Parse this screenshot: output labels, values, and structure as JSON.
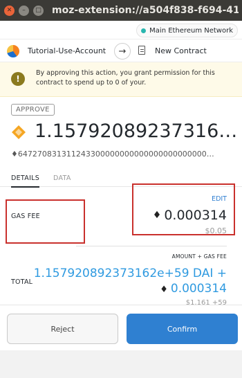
{
  "window": {
    "title": "moz-extension://a504f838-f694-413d-",
    "close_glyph": "✕",
    "minimize_glyph": "–",
    "maximize_glyph": "□"
  },
  "network": {
    "label": "Main Ethereum Network",
    "status_color": "#29b6af"
  },
  "account_bar": {
    "account_name": "Tutorial-Use-Account",
    "arrow_icon": "arrow-right-icon",
    "arrow_glyph": "→",
    "contract_label": "New Contract"
  },
  "warning": {
    "icon": "exclamation-icon",
    "icon_glyph": "!",
    "text": "By approving this action, you grant permission for this contract to spend up to 0 of your."
  },
  "transaction": {
    "action_tag": "APPROVE",
    "amount": "1.15792089237316…",
    "subamount": "♦647270831311243300000000000000000000000…"
  },
  "tabs": [
    {
      "label": "DETAILS",
      "active": true
    },
    {
      "label": "DATA",
      "active": false
    }
  ],
  "gas": {
    "label": "GAS FEE",
    "edit_label": "EDIT",
    "eth_glyph": "♦",
    "eth_value": "0.000314",
    "usd_value": "$0.05"
  },
  "total": {
    "caption": "AMOUNT + GAS FEE",
    "label": "TOTAL",
    "value_line1": "1.15792089237316​2e+59 DAI +",
    "eth_glyph": "♦",
    "value_line2": "0.000314",
    "usd_value": "$1.161 +59"
  },
  "buttons": {
    "reject_label": "Reject",
    "confirm_label": "Confirm"
  },
  "colors": {
    "accent": "#2f80d1",
    "total_value": "#2f9ae0",
    "highlight": "#c9302c",
    "warning_bg": "#fefae8"
  }
}
